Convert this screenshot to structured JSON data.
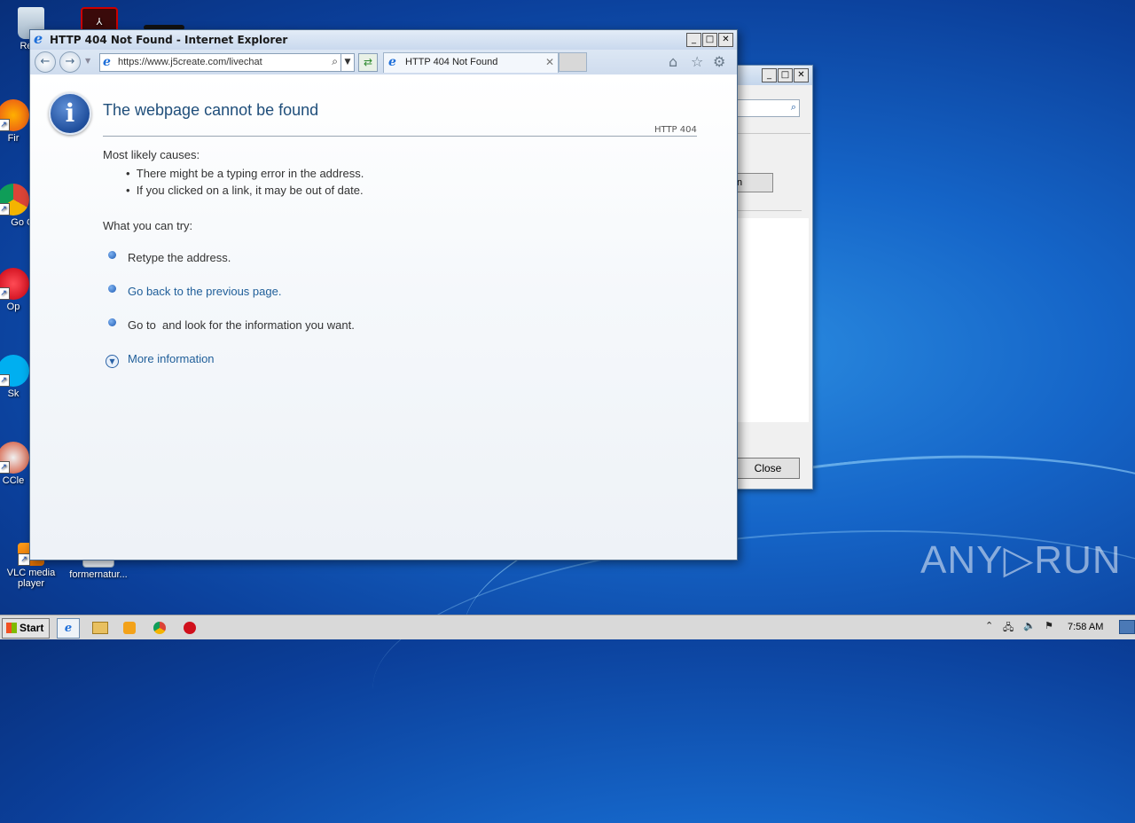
{
  "desktop": {
    "icons": [
      {
        "label": "Recy",
        "name": "recycle-bin-icon"
      },
      {
        "label": "Fir",
        "name": "firefox-icon"
      },
      {
        "label": "Go Chr",
        "name": "chrome-icon"
      },
      {
        "label": "Op",
        "name": "opera-icon"
      },
      {
        "label": "Sk",
        "name": "skype-icon"
      },
      {
        "label": "CCle",
        "name": "ccleaner-icon"
      },
      {
        "label": "VLC media player",
        "name": "vlc-icon"
      },
      {
        "label": "formernatur...",
        "name": "file-icon"
      }
    ],
    "watermark": "ANY▷RUN"
  },
  "background_dialog": {
    "close_label": "Close",
    "button_partial": "n"
  },
  "ie": {
    "title": "HTTP 404 Not Found - Internet Explorer",
    "address": "https://www.j5create.com/livechat",
    "tab_title": "HTTP 404 Not Found",
    "page": {
      "heading": "The webpage cannot be found",
      "code": "HTTP 404",
      "causes_title": "Most likely causes:",
      "causes": [
        "There might be a typing error in the address.",
        "If you clicked on a link, it may be out of date."
      ],
      "try_title": "What you can try:",
      "try_items": [
        "Retype the address.",
        "Go back to the previous page.",
        "Go to  and look for the information you want."
      ],
      "more_info": "More information"
    }
  },
  "taskbar": {
    "start_label": "Start",
    "clock": "7:58 AM"
  },
  "colors": {
    "link": "#1f5e99",
    "heading": "#1f4e7a",
    "desktop": "#1565c8"
  }
}
